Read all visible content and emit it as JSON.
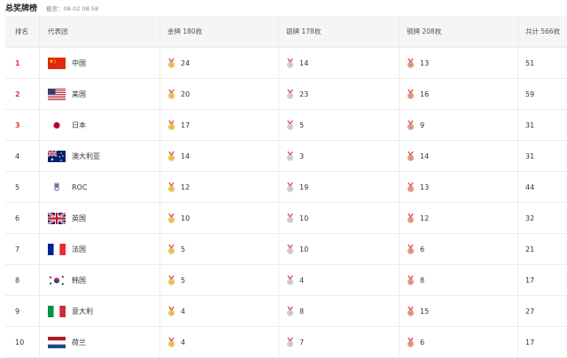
{
  "header": {
    "title": "总奖牌榜",
    "updated": "截至：08-02 08:58"
  },
  "table": {
    "columns": {
      "rank": "排名",
      "team": "代表团",
      "gold": "金牌 180枚",
      "silver": "银牌 178枚",
      "bronze": "铜牌 208枚",
      "total": "共计 566枚"
    },
    "rows": [
      {
        "rank": "1",
        "flag": "china-flag",
        "team": "中国",
        "gold": "24",
        "silver": "14",
        "bronze": "13",
        "total": "51"
      },
      {
        "rank": "2",
        "flag": "usa-flag",
        "team": "美国",
        "gold": "20",
        "silver": "23",
        "bronze": "16",
        "total": "59"
      },
      {
        "rank": "3",
        "flag": "japan-flag",
        "team": "日本",
        "gold": "17",
        "silver": "5",
        "bronze": "9",
        "total": "31"
      },
      {
        "rank": "4",
        "flag": "australia-flag",
        "team": "澳大利亚",
        "gold": "14",
        "silver": "3",
        "bronze": "14",
        "total": "31"
      },
      {
        "rank": "5",
        "flag": "roc-emblem",
        "team": "ROC",
        "gold": "12",
        "silver": "19",
        "bronze": "13",
        "total": "44"
      },
      {
        "rank": "6",
        "flag": "uk-flag",
        "team": "英国",
        "gold": "10",
        "silver": "10",
        "bronze": "12",
        "total": "32"
      },
      {
        "rank": "7",
        "flag": "france-flag",
        "team": "法国",
        "gold": "5",
        "silver": "10",
        "bronze": "6",
        "total": "21"
      },
      {
        "rank": "8",
        "flag": "korea-flag",
        "team": "韩国",
        "gold": "5",
        "silver": "4",
        "bronze": "8",
        "total": "17"
      },
      {
        "rank": "9",
        "flag": "italy-flag",
        "team": "意大利",
        "gold": "4",
        "silver": "8",
        "bronze": "15",
        "total": "27"
      },
      {
        "rank": "10",
        "flag": "netherlands-flag",
        "team": "荷兰",
        "gold": "4",
        "silver": "7",
        "bronze": "6",
        "total": "17"
      }
    ]
  },
  "colors": {
    "top_rank": "#e03a3a",
    "gold": "#e8b53a",
    "silver": "#c4c4c4",
    "bronze": "#d48b6a",
    "ribbon": "#e05050"
  }
}
